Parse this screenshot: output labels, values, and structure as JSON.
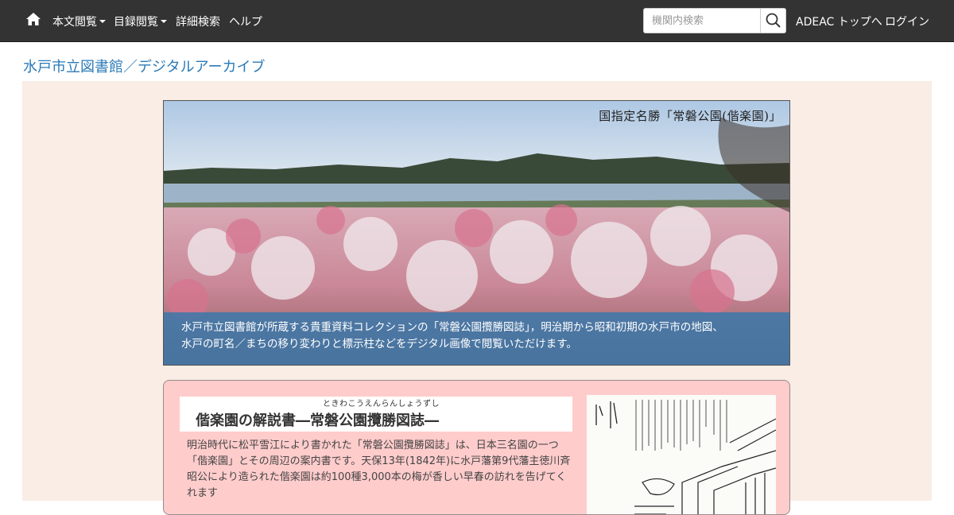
{
  "navbar": {
    "home_icon": "home-icon",
    "items": [
      {
        "label": "本文閲覧",
        "has_dropdown": true
      },
      {
        "label": "目録閲覧",
        "has_dropdown": true
      },
      {
        "label": "詳細検索",
        "has_dropdown": false
      },
      {
        "label": "ヘルプ",
        "has_dropdown": false
      }
    ],
    "search": {
      "placeholder": "機関内検索",
      "value": "",
      "icon": "search-icon"
    },
    "right_links": [
      "ADEAC トップへ",
      "ログイン"
    ]
  },
  "site_title": "水戸市立図書館／デジタルアーカイブ",
  "hero": {
    "caption": "国指定名勝「常磐公園(偕楽園)」",
    "description_line1": "水戸市立図書館が所蔵する貴重資料コレクションの「常磐公園攬勝図誌」，明治期から昭和初期の水戸市の地図、",
    "description_line2": "水戸の町名／まちの移り変わりと標示柱などをデジタル画像で閲覧いただけます。"
  },
  "feature": {
    "ruby": "ときわこうえんらんしょうずし",
    "title": "偕楽園の解説書―常磐公園攬勝図誌―",
    "description": "明治時代に松平雪江により書かれた「常磐公園攬勝図誌」は、日本三名園の一つ「偕楽園」とその周辺の案内書です。天保13年(1842年)に水戸藩第9代藩主徳川斉昭公により造られた偕楽園は約100種3,000本の梅が香しい早春の訪れを告げてくれます"
  },
  "colors": {
    "navbar_bg": "#333333",
    "title_link": "#2a7ab8",
    "page_bg": "#f9ede5",
    "overlay": "#3c78aa",
    "card_bg": "#ffcccc"
  }
}
